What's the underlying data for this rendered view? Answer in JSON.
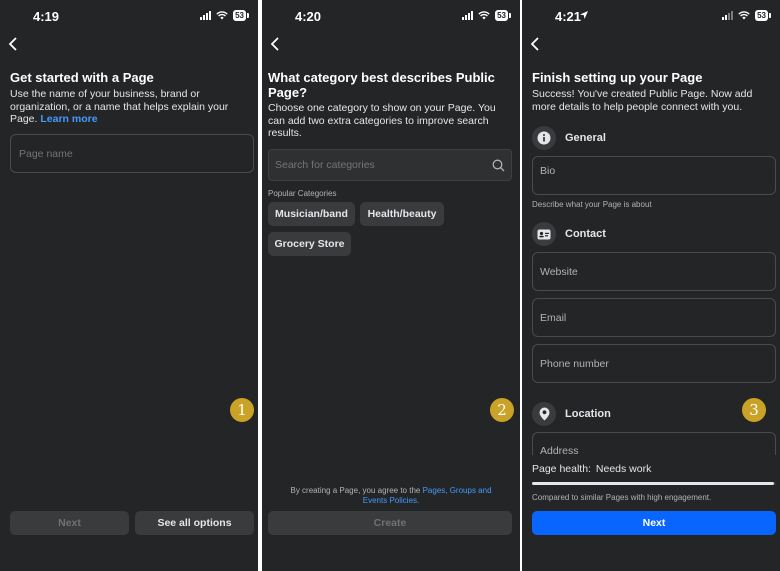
{
  "screens": [
    {
      "status": {
        "time": "4:19",
        "battery": "53"
      },
      "title": "Get started with a Page",
      "desc_text": "Use the name of your business, brand or organization, or a name that helps explain your Page. ",
      "desc_link": "Learn more",
      "page_name_placeholder": "Page name",
      "next_label": "Next",
      "see_all_label": "See all options",
      "step": "1"
    },
    {
      "status": {
        "time": "4:20",
        "battery": "53"
      },
      "title": "What category best describes Public Page?",
      "desc": "Choose one category to show on your Page. You can add two extra categories to improve search results.",
      "search_placeholder": "Search for categories",
      "popular_label": "Popular Categories",
      "categories": [
        "Musician/band",
        "Health/beauty",
        "Grocery Store"
      ],
      "terms_text": "By creating a Page, you agree to the ",
      "terms_link": "Pages, Groups and Events Policies.",
      "create_label": "Create",
      "step": "2"
    },
    {
      "status": {
        "time": "4:21",
        "battery": "53"
      },
      "title": "Finish setting up your Page",
      "desc": "Success! You've created Public Page. Now add more details to help people connect with you.",
      "general_label": "General",
      "bio_placeholder": "Bio",
      "bio_hint": "Describe what your Page is about",
      "contact_label": "Contact",
      "website_placeholder": "Website",
      "email_placeholder": "Email",
      "phone_placeholder": "Phone number",
      "location_label": "Location",
      "address_placeholder": "Address",
      "health_label": "Page health:",
      "health_value": "Needs work",
      "health_caption": "Compared to similar Pages with high engagement.",
      "health_progress": 0.99,
      "next_label": "Next",
      "step": "3"
    }
  ],
  "colors": {
    "background": "#242526",
    "accent": "#0866ff",
    "link": "#4599ff",
    "badge": "#c9a227"
  }
}
